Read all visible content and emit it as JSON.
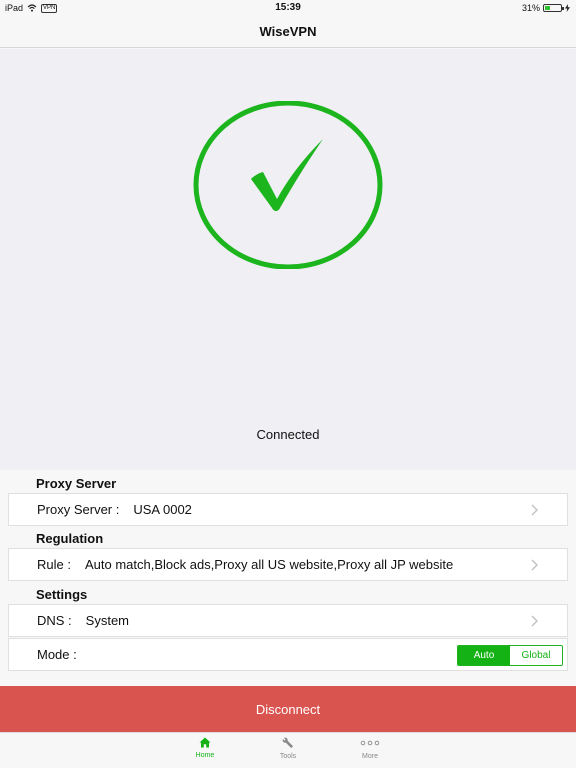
{
  "status_bar": {
    "device": "iPad",
    "vpn_badge": "VPN",
    "time": "15:39",
    "battery_percent": "31%",
    "battery_level": 0.31
  },
  "nav": {
    "title": "WiseVPN"
  },
  "hero": {
    "status": "Connected",
    "accent_color": "#1db51d"
  },
  "proxy_server": {
    "header": "Proxy Server",
    "label": "Proxy Server :",
    "value": "USA 0002"
  },
  "regulation": {
    "header": "Regulation",
    "label": "Rule :",
    "value": "Auto match,Block ads,Proxy all US website,Proxy all JP website"
  },
  "settings": {
    "header": "Settings",
    "dns_label": "DNS :",
    "dns_value": "System",
    "mode_label": "Mode :",
    "mode_options": [
      "Auto",
      "Global"
    ],
    "mode_selected": "Auto"
  },
  "disconnect": {
    "label": "Disconnect",
    "color": "#d9534f"
  },
  "tab_bar": {
    "tabs": [
      {
        "label": "Home",
        "icon": "home-icon",
        "active": true
      },
      {
        "label": "Tools",
        "icon": "wrench-icon",
        "active": false
      },
      {
        "label": "More",
        "icon": "more-dots-icon",
        "active": false
      }
    ]
  }
}
